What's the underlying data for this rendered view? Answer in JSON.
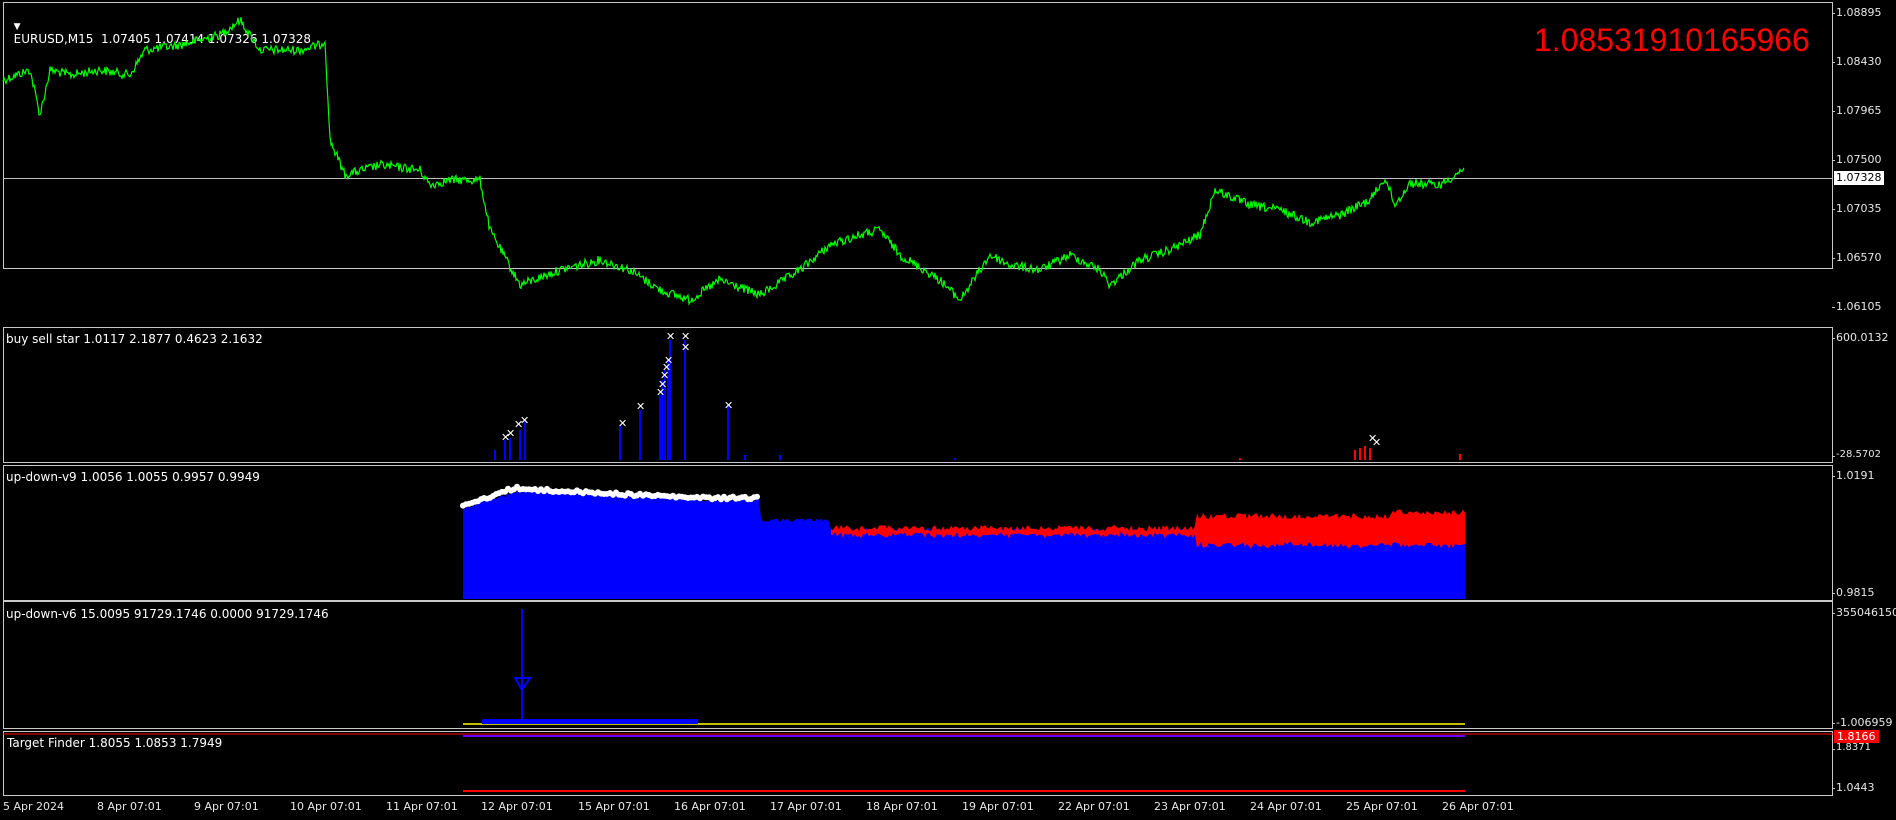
{
  "main_pane": {
    "title": "EURUSD,M15  1.07405 1.07414 1.07326 1.07328",
    "big_value": "1.08531910165966",
    "current_price": "1.07328",
    "scale": [
      "1.08895",
      "1.08430",
      "1.07965",
      "1.07500",
      "1.07035",
      "1.06570",
      "1.06105"
    ],
    "line_color": "#00ff00"
  },
  "pane_buy_sell": {
    "title": "buy sell star 1.0117 2.1877 0.4623 2.1632",
    "scale_top": "600.0132",
    "scale_bottom": "-28.5702",
    "bar_color": "#0000ff",
    "star_color": "#ffffff"
  },
  "pane_updown_v9": {
    "title": "up-down-v9 1.0056 1.0055 0.9957 0.9949",
    "scale_top": "1.0191",
    "scale_bottom": "0.9815",
    "fill_color": "#0000ff",
    "upper_color": "#ff0000"
  },
  "pane_updown_v6": {
    "title": "up-down-v6 15.0095 91729.1746 0.0000 91729.1746",
    "scale_top": "355046150",
    "scale_bottom": "-1.006959",
    "bar_color": "#0000ff",
    "line_color": "#ffff00"
  },
  "pane_target": {
    "title": "Target Finder 1.8055 1.0853 1.7949",
    "scale_top": "1.8166",
    "scale_mid": "1.8371",
    "scale_bottom": "1.0443"
  },
  "time_axis": [
    "5 Apr 2024",
    "8 Apr 07:01",
    "9 Apr 07:01",
    "10 Apr 07:01",
    "11 Apr 07:01",
    "12 Apr 07:01",
    "15 Apr 07:01",
    "16 Apr 07:01",
    "17 Apr 07:01",
    "18 Apr 07:01",
    "19 Apr 07:01",
    "22 Apr 07:01",
    "23 Apr 07:01",
    "24 Apr 07:01",
    "25 Apr 07:01",
    "26 Apr 07:01"
  ]
}
